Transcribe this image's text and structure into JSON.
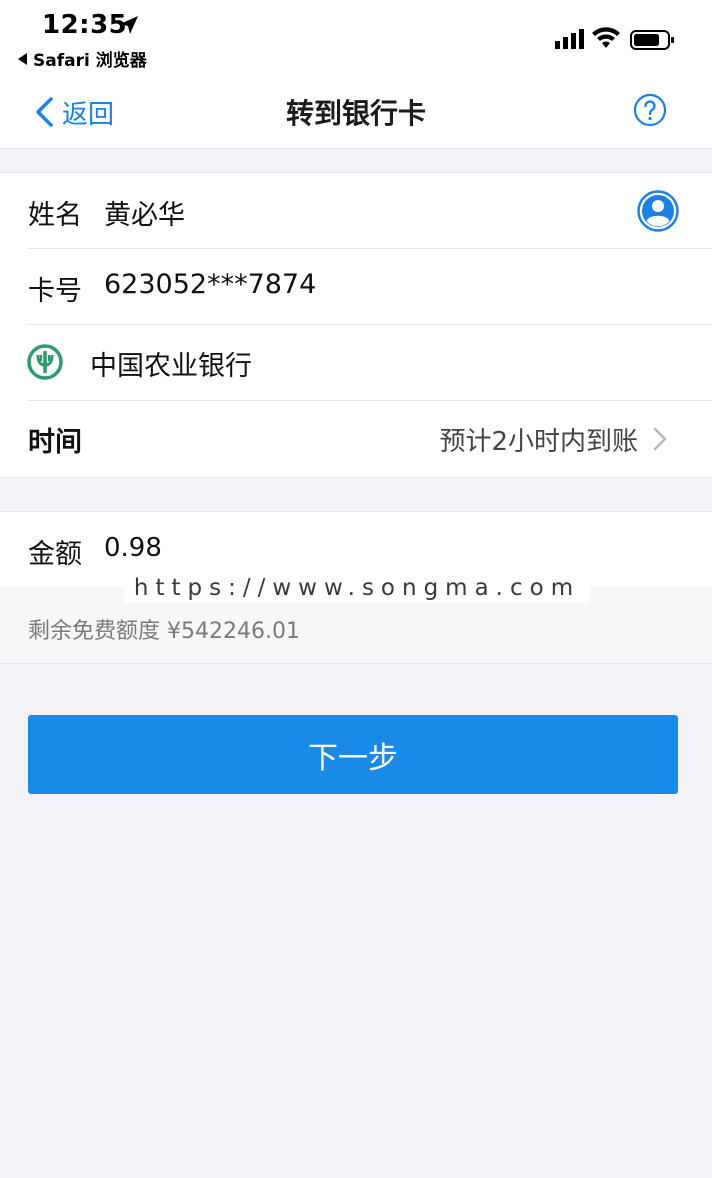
{
  "status_bar": {
    "time": "12:35",
    "back_app": "Safari 浏览器"
  },
  "nav": {
    "back_label": "返回",
    "title": "转到银行卡"
  },
  "form": {
    "name_label": "姓名",
    "name_value": "黄必华",
    "card_label": "卡号",
    "card_value": "623052***7874",
    "bank_name": "中国农业银行",
    "time_label": "时间",
    "time_value": "预计2小时内到账",
    "amount_label": "金额",
    "amount_value": "0.98"
  },
  "watermark": "https://www.songma.com",
  "quota": {
    "text": "剩余免费额度 ¥542246.01"
  },
  "next_button": "下一步",
  "colors": {
    "accent": "#1a82e6",
    "button": "#1a8ae8",
    "bank_logo": "#2e9a6b"
  }
}
